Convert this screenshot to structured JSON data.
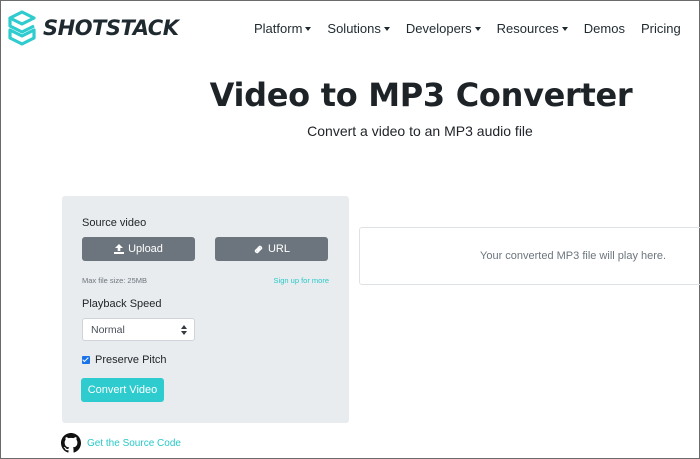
{
  "header": {
    "logo_text": "SHOTSTACK",
    "nav": [
      "Platform",
      "Solutions",
      "Developers",
      "Resources",
      "Demos",
      "Pricing"
    ]
  },
  "hero": {
    "title": "Video to MP3 Converter",
    "subtitle": "Convert a video to an MP3 audio file"
  },
  "form": {
    "source_label": "Source video",
    "upload_label": "Upload",
    "url_label": "URL",
    "max_size": "Max file size: 25MB",
    "signup_link": "Sign up for more",
    "speed_label": "Playback Speed",
    "speed_value": "Normal",
    "preserve_pitch_label": "Preserve Pitch",
    "preserve_pitch_checked": true,
    "convert_label": "Convert Video"
  },
  "result": {
    "placeholder": "Your converted MP3 file will play here."
  },
  "footer": {
    "source_link": "Get the Source Code"
  },
  "colors": {
    "accent": "#2ecbcf",
    "button_gray": "#6c757d",
    "panel_bg": "#e9ecef"
  }
}
